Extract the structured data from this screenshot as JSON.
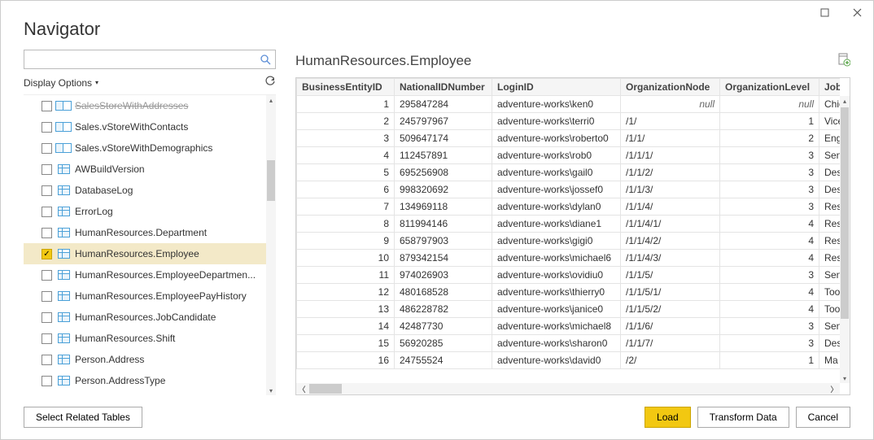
{
  "window": {
    "title": "Navigator",
    "max_label": "Maximize",
    "close_label": "Close"
  },
  "search": {
    "placeholder": ""
  },
  "displayOptions": {
    "label": "Display Options"
  },
  "tree": {
    "items": [
      {
        "label": "SalesStoreWithAddresses",
        "type": "view",
        "checked": false,
        "cut": true
      },
      {
        "label": "Sales.vStoreWithContacts",
        "type": "view",
        "checked": false
      },
      {
        "label": "Sales.vStoreWithDemographics",
        "type": "view",
        "checked": false
      },
      {
        "label": "AWBuildVersion",
        "type": "table",
        "checked": false
      },
      {
        "label": "DatabaseLog",
        "type": "table",
        "checked": false
      },
      {
        "label": "ErrorLog",
        "type": "table",
        "checked": false
      },
      {
        "label": "HumanResources.Department",
        "type": "table",
        "checked": false
      },
      {
        "label": "HumanResources.Employee",
        "type": "table",
        "checked": true,
        "selected": true
      },
      {
        "label": "HumanResources.EmployeeDepartmen...",
        "type": "table",
        "checked": false
      },
      {
        "label": "HumanResources.EmployeePayHistory",
        "type": "table",
        "checked": false
      },
      {
        "label": "HumanResources.JobCandidate",
        "type": "table",
        "checked": false
      },
      {
        "label": "HumanResources.Shift",
        "type": "table",
        "checked": false
      },
      {
        "label": "Person.Address",
        "type": "table",
        "checked": false
      },
      {
        "label": "Person.AddressType",
        "type": "table",
        "checked": false
      }
    ]
  },
  "preview": {
    "title": "HumanResources.Employee",
    "columns": [
      "BusinessEntityID",
      "NationalIDNumber",
      "LoginID",
      "OrganizationNode",
      "OrganizationLevel",
      "JobTitle"
    ],
    "rows": [
      {
        "id": "1",
        "nid": "295847284",
        "login": "adventure-works\\ken0",
        "node": "null",
        "lvl": "null",
        "job": "Chie"
      },
      {
        "id": "2",
        "nid": "245797967",
        "login": "adventure-works\\terri0",
        "node": "/1/",
        "lvl": "1",
        "job": "Vice"
      },
      {
        "id": "3",
        "nid": "509647174",
        "login": "adventure-works\\roberto0",
        "node": "/1/1/",
        "lvl": "2",
        "job": "Eng"
      },
      {
        "id": "4",
        "nid": "112457891",
        "login": "adventure-works\\rob0",
        "node": "/1/1/1/",
        "lvl": "3",
        "job": "Sen"
      },
      {
        "id": "5",
        "nid": "695256908",
        "login": "adventure-works\\gail0",
        "node": "/1/1/2/",
        "lvl": "3",
        "job": "Des"
      },
      {
        "id": "6",
        "nid": "998320692",
        "login": "adventure-works\\jossef0",
        "node": "/1/1/3/",
        "lvl": "3",
        "job": "Des"
      },
      {
        "id": "7",
        "nid": "134969118",
        "login": "adventure-works\\dylan0",
        "node": "/1/1/4/",
        "lvl": "3",
        "job": "Res"
      },
      {
        "id": "8",
        "nid": "811994146",
        "login": "adventure-works\\diane1",
        "node": "/1/1/4/1/",
        "lvl": "4",
        "job": "Res"
      },
      {
        "id": "9",
        "nid": "658797903",
        "login": "adventure-works\\gigi0",
        "node": "/1/1/4/2/",
        "lvl": "4",
        "job": "Res"
      },
      {
        "id": "10",
        "nid": "879342154",
        "login": "adventure-works\\michael6",
        "node": "/1/1/4/3/",
        "lvl": "4",
        "job": "Res"
      },
      {
        "id": "11",
        "nid": "974026903",
        "login": "adventure-works\\ovidiu0",
        "node": "/1/1/5/",
        "lvl": "3",
        "job": "Sen"
      },
      {
        "id": "12",
        "nid": "480168528",
        "login": "adventure-works\\thierry0",
        "node": "/1/1/5/1/",
        "lvl": "4",
        "job": "Too"
      },
      {
        "id": "13",
        "nid": "486228782",
        "login": "adventure-works\\janice0",
        "node": "/1/1/5/2/",
        "lvl": "4",
        "job": "Too"
      },
      {
        "id": "14",
        "nid": "42487730",
        "login": "adventure-works\\michael8",
        "node": "/1/1/6/",
        "lvl": "3",
        "job": "Sen"
      },
      {
        "id": "15",
        "nid": "56920285",
        "login": "adventure-works\\sharon0",
        "node": "/1/1/7/",
        "lvl": "3",
        "job": "Des"
      },
      {
        "id": "16",
        "nid": "24755524",
        "login": "adventure-works\\david0",
        "node": "/2/",
        "lvl": "1",
        "job": "Ma"
      }
    ]
  },
  "footer": {
    "select_related": "Select Related Tables",
    "load": "Load",
    "transform": "Transform Data",
    "cancel": "Cancel"
  }
}
